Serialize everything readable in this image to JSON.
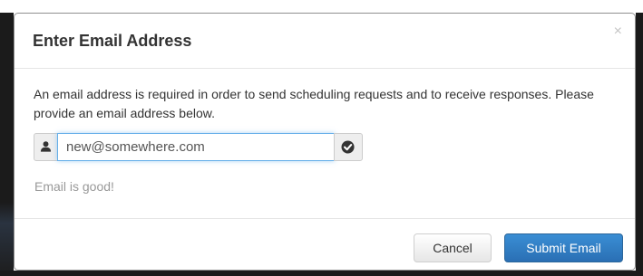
{
  "dialog": {
    "title": "Enter Email Address",
    "close_label": "×",
    "message": "An email address is required in order to send scheduling requests and to receive responses. Please provide an email address below."
  },
  "email_input": {
    "value": "new@somewhere.com",
    "left_icon": "user-icon",
    "right_icon": "check-circle-icon"
  },
  "status": {
    "text": "Email is good!"
  },
  "footer": {
    "cancel_label": "Cancel",
    "submit_label": "Submit Email"
  },
  "colors": {
    "primary": "#337ab7",
    "input_focus": "#66afe9",
    "status_text": "#999999"
  }
}
